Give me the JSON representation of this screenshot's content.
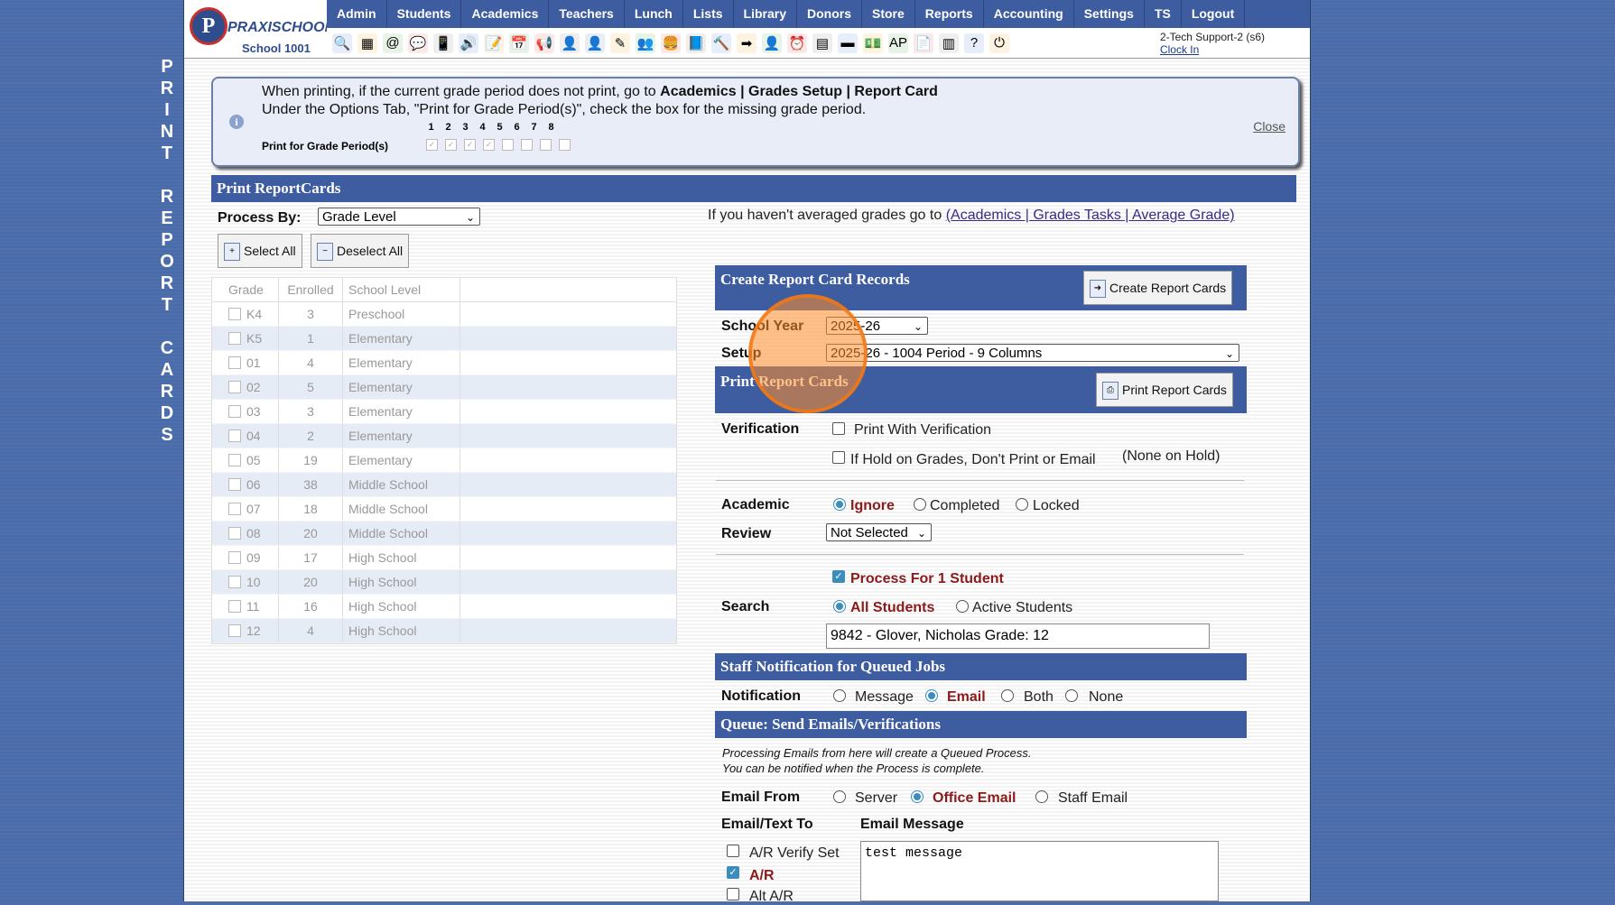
{
  "side_title": "P\nR\nI\nN\nT\n\nR\nE\nP\nO\nR\nT\n\nC\nA\nR\nD\nS",
  "logo": {
    "initial": "P",
    "brand": "PRAXISCHOOL",
    "school": "School 1001"
  },
  "menu": [
    "Admin",
    "Students",
    "Academics",
    "Teachers",
    "Lunch",
    "Lists",
    "Library",
    "Donors",
    "Store",
    "Reports",
    "Accounting",
    "Settings",
    "TS",
    "Logout"
  ],
  "toolbar_icons": [
    {
      "name": "search",
      "glyph": "🔍"
    },
    {
      "name": "grid",
      "glyph": "▦"
    },
    {
      "name": "at",
      "glyph": "@"
    },
    {
      "name": "chat",
      "glyph": "💬"
    },
    {
      "name": "phone",
      "glyph": "📱"
    },
    {
      "name": "speaker",
      "glyph": "🔊"
    },
    {
      "name": "calendar-edit",
      "glyph": "📝"
    },
    {
      "name": "calendar",
      "glyph": "📅"
    },
    {
      "name": "megaphone",
      "glyph": "📢"
    },
    {
      "name": "person-red",
      "glyph": "👤"
    },
    {
      "name": "person-orange",
      "glyph": "👤"
    },
    {
      "name": "pencil",
      "glyph": "✎"
    },
    {
      "name": "group",
      "glyph": "👥"
    },
    {
      "name": "lunch",
      "glyph": "🍔"
    },
    {
      "name": "book",
      "glyph": "📘"
    },
    {
      "name": "gavel",
      "glyph": "🔨"
    },
    {
      "name": "arrow-right",
      "glyph": "➡"
    },
    {
      "name": "staff",
      "glyph": "👤"
    },
    {
      "name": "clock",
      "glyph": "⏰"
    },
    {
      "name": "table",
      "glyph": "▤"
    },
    {
      "name": "card",
      "glyph": "▬"
    },
    {
      "name": "cash",
      "glyph": "💵"
    },
    {
      "name": "ar",
      "glyph": "AP"
    },
    {
      "name": "pdf",
      "glyph": "📄"
    },
    {
      "name": "stack",
      "glyph": "▥"
    },
    {
      "name": "help",
      "glyph": "?"
    },
    {
      "name": "power",
      "glyph": "⏻"
    }
  ],
  "user": {
    "name": "2-Tech Support-2 (s6)",
    "clock_in": "Clock In"
  },
  "info": {
    "line1_prefix": "When printing, if the current grade period does not print, go to ",
    "line1_bold": "Academics | Grades Setup | Report Card",
    "line2": "Under the Options Tab, \"Print for Grade Period(s)\", check the box for the missing grade period.",
    "gp_numbers": [
      "1",
      "2",
      "3",
      "4",
      "5",
      "6",
      "7",
      "8"
    ],
    "gp_label": "Print for Grade Period(s)",
    "gp_checked": [
      true,
      true,
      true,
      true,
      false,
      false,
      false,
      false
    ],
    "close": "Close"
  },
  "print_header": "Print ReportCards",
  "process_by": {
    "label": "Process By:",
    "value": "Grade Level"
  },
  "avg_note": {
    "text": "If you haven't averaged grades go to ",
    "link": "(Academics | Grades Tasks | Average Grade)"
  },
  "buttons": {
    "select_all": "Select All",
    "deselect_all": "Deselect All"
  },
  "grade_table": {
    "headers": [
      "Grade",
      "Enrolled",
      "School Level"
    ],
    "rows": [
      [
        "K4",
        "3",
        "Preschool"
      ],
      [
        "K5",
        "1",
        "Elementary"
      ],
      [
        "01",
        "4",
        "Elementary"
      ],
      [
        "02",
        "5",
        "Elementary"
      ],
      [
        "03",
        "3",
        "Elementary"
      ],
      [
        "04",
        "2",
        "Elementary"
      ],
      [
        "05",
        "19",
        "Elementary"
      ],
      [
        "06",
        "38",
        "Middle School"
      ],
      [
        "07",
        "18",
        "Middle School"
      ],
      [
        "08",
        "20",
        "Middle School"
      ],
      [
        "09",
        "17",
        "High School"
      ],
      [
        "10",
        "20",
        "High School"
      ],
      [
        "11",
        "16",
        "High School"
      ],
      [
        "12",
        "4",
        "High School"
      ]
    ]
  },
  "create": {
    "header": "Create Report Card Records",
    "button": "Create Report Cards"
  },
  "school_year": {
    "label": "School Year",
    "value": "2025-26"
  },
  "setup": {
    "label": "Setup",
    "value": "2025-26 - 1004 Period - 9 Columns"
  },
  "print_rc": {
    "header": "Print Report Cards",
    "button": "Print Report Cards"
  },
  "verification": {
    "label": "Verification",
    "opt1": "Print With Verification",
    "opt2": "If Hold on Grades, Don't Print or Email",
    "hold_note": "(None on Hold)"
  },
  "academic": {
    "label1": "Academic",
    "label2": "Review",
    "opt_ignore": "Ignore",
    "opt_completed": "Completed",
    "opt_locked": "Locked",
    "review_value": "Not Selected"
  },
  "process_student": "Process For 1 Student",
  "search": {
    "label": "Search",
    "all": "All Students",
    "active": "Active Students",
    "value": "9842 - Glover, Nicholas Grade: 12"
  },
  "staff_notify": {
    "header": "Staff Notification for Queued Jobs",
    "label": "Notification",
    "message": "Message",
    "email": "Email",
    "both": "Both",
    "none": "None"
  },
  "queue": {
    "header": "Queue: Send Emails/Verifications",
    "note1": "Processing Emails from here will create a Queued Process.",
    "note2": "You can be notified when the Process is complete."
  },
  "email_from": {
    "label": "Email From",
    "server": "Server",
    "office": "Office Email",
    "staff": "Staff Email"
  },
  "email_to": {
    "label": "Email/Text To",
    "msg_label": "Email Message",
    "opt1": "A/R Verify Set",
    "opt2": "A/R",
    "opt3": "Alt A/R",
    "message": "test message"
  }
}
